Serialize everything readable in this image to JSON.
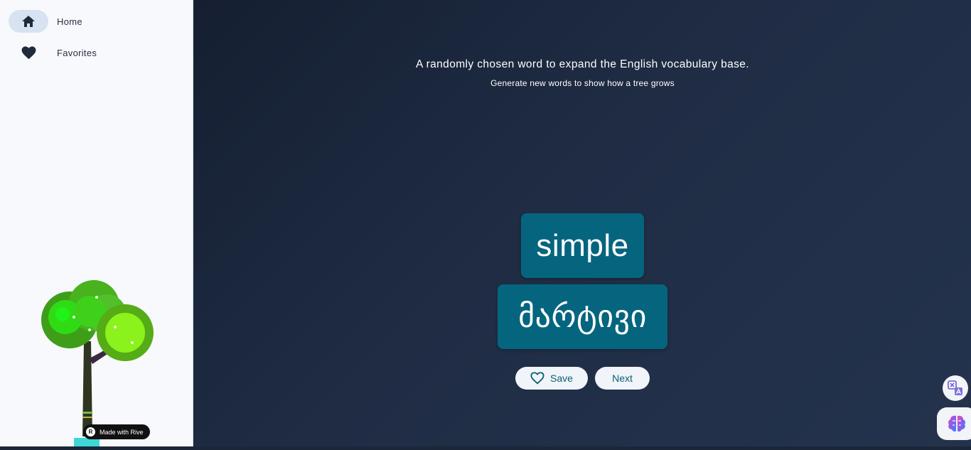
{
  "nav": {
    "items": [
      {
        "label": "Home",
        "icon": "home-icon",
        "active": true
      },
      {
        "label": "Favorites",
        "icon": "heart-icon",
        "active": false
      }
    ]
  },
  "badge": {
    "label": "Made with Rive"
  },
  "main": {
    "headline": "A randomly chosen word to expand the English vocabulary base.",
    "subline": "Generate new words to show how a tree grows",
    "word": "simple",
    "translation": "მარტივი",
    "save_label": "Save",
    "next_label": "Next"
  },
  "colors": {
    "card": "#05657f",
    "background": "#1b2638",
    "sidebar": "#f7f9fd",
    "accent": "#0a5e73"
  }
}
